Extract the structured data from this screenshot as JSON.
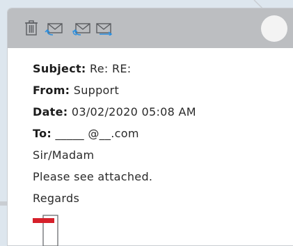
{
  "toolbar": {
    "icons": [
      "trash-icon",
      "reply-mail-icon",
      "reply-all-mail-icon",
      "forward-mail-icon"
    ]
  },
  "email": {
    "subject_label": "Subject:",
    "subject_value": "Re: RE:",
    "from_label": "From:",
    "from_value": "Support",
    "date_label": "Date:",
    "date_value": "03/02/2020 05:08 AM",
    "to_label": "To:",
    "to_value": "_____ @__.com",
    "body": [
      "Sir/Madam",
      "Please see attached.",
      "Regards"
    ]
  },
  "colors": {
    "toolbar_bg": "#bcbec1",
    "accent_blue": "#2a8fe0",
    "attachment_red": "#d6202a"
  }
}
